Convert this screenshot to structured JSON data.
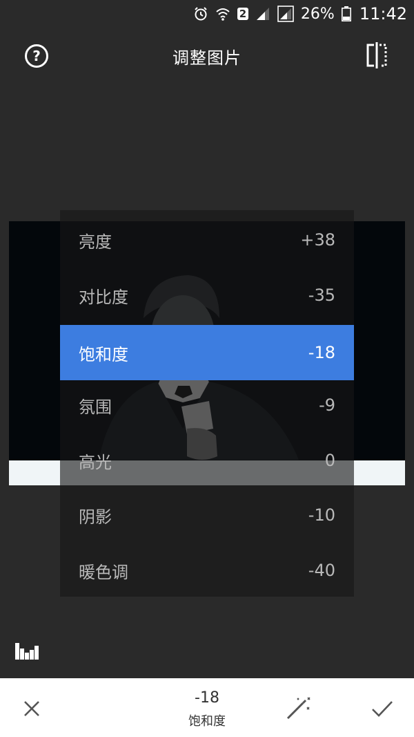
{
  "status_bar": {
    "sim_slot": "2",
    "battery_percent": "26%",
    "time": "11:42",
    "icons": [
      "alarm-icon",
      "wifi-icon",
      "sim-icon",
      "signal-icon",
      "signal-icon",
      "battery-icon"
    ]
  },
  "header": {
    "title": "调整图片",
    "help_label": "?",
    "help_icon": "help-icon",
    "compare_icon": "compare-icon"
  },
  "adjustments": [
    {
      "label": "亮度",
      "value": "+38"
    },
    {
      "label": "对比度",
      "value": "-35"
    },
    {
      "label": "饱和度",
      "value": "-18",
      "selected": true
    },
    {
      "label": "氛围",
      "value": "-9"
    },
    {
      "label": "高光",
      "value": "0"
    },
    {
      "label": "阴影",
      "value": "-10"
    },
    {
      "label": "暖色调",
      "value": "-40"
    }
  ],
  "footer": {
    "current_value": "-18",
    "current_param": "饱和度",
    "cancel_icon": "close-icon",
    "auto_icon": "magic-wand-icon",
    "apply_icon": "checkmark-icon",
    "histogram_icon": "histogram-icon"
  },
  "colors": {
    "background": "#2a2a2a",
    "selected": "#3d7de0",
    "toolbar": "#ffffff"
  }
}
